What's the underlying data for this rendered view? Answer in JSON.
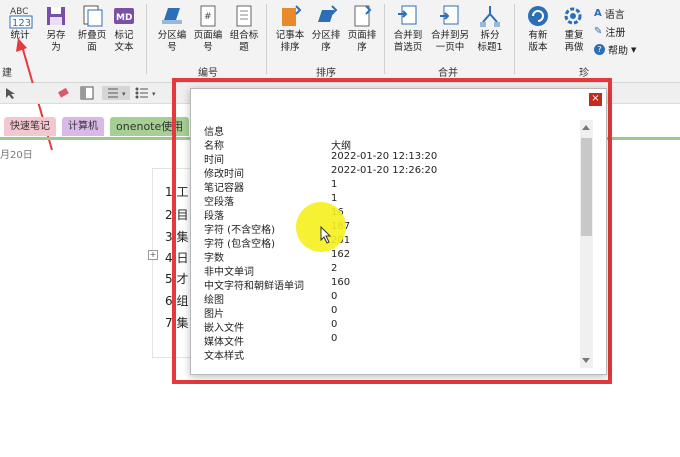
{
  "ribbon": {
    "buttons": [
      {
        "label": "统计"
      },
      {
        "label": "另存",
        "label2": "为"
      },
      {
        "label": "折叠页",
        "label2": "面"
      },
      {
        "label": "标记",
        "label2": "文本"
      },
      {
        "label": "分区编",
        "label2": "号"
      },
      {
        "label": "页面编",
        "label2": "号"
      },
      {
        "label": "组合标",
        "label2": "题"
      },
      {
        "label": "记事本",
        "label2": "排序"
      },
      {
        "label": "分区排",
        "label2": "序"
      },
      {
        "label": "页面排",
        "label2": "序"
      },
      {
        "label": "合并到",
        "label2": "首选页"
      },
      {
        "label": "合并到另",
        "label2": "一页中"
      },
      {
        "label": "拆分",
        "label2": "标题1"
      },
      {
        "label": "有新",
        "label2": "版本"
      },
      {
        "label": "重复",
        "label2": "再做"
      }
    ],
    "small": {
      "language": "语言",
      "register": "注册",
      "help": "帮助"
    },
    "groups": {
      "edit_cut": "建",
      "number": "编号",
      "sort": "排序",
      "merge": "合并",
      "treasure": "珍"
    },
    "icon_text": {
      "abc": "ABC",
      "num": "123",
      "md": "MD"
    }
  },
  "tabs": [
    {
      "label": "快速笔记",
      "color": "#f4c7d0"
    },
    {
      "label": "计算机",
      "color": "#d8b9e8"
    },
    {
      "label": "onenote使用",
      "color": "#a6cf96"
    }
  ],
  "date_fragment": "月20日",
  "page_list": [
    "1",
    "2",
    "3",
    "4",
    "5",
    "6",
    "7"
  ],
  "page_list_tail": [
    "工",
    "目",
    "集",
    "日",
    "才",
    "组",
    "集"
  ],
  "dialog": {
    "header": "信息",
    "rows": [
      {
        "k": "名称",
        "v": "大纲"
      },
      {
        "k": "时间",
        "v": "2022-01-20 12:13:20"
      },
      {
        "k": "修改时间",
        "v": "2022-01-20 12:26:20"
      },
      {
        "k": "笔记容器",
        "v": "1"
      },
      {
        "k": "空段落",
        "v": "1"
      },
      {
        "k": "段落",
        "v": "16"
      },
      {
        "k": "字符 (不含空格)",
        "v": "187"
      },
      {
        "k": "字符 (包含空格)",
        "v": "201"
      },
      {
        "k": "字数",
        "v": "162"
      },
      {
        "k": "非中文单词",
        "v": "2"
      },
      {
        "k": "中文字符和朝鲜语单词",
        "v": "160"
      },
      {
        "k": "绘图",
        "v": "0"
      },
      {
        "k": "图片",
        "v": "0"
      },
      {
        "k": "嵌入文件",
        "v": "0"
      },
      {
        "k": "媒体文件",
        "v": "0"
      },
      {
        "k": "文本样式",
        "v": ""
      }
    ],
    "close": "×"
  }
}
